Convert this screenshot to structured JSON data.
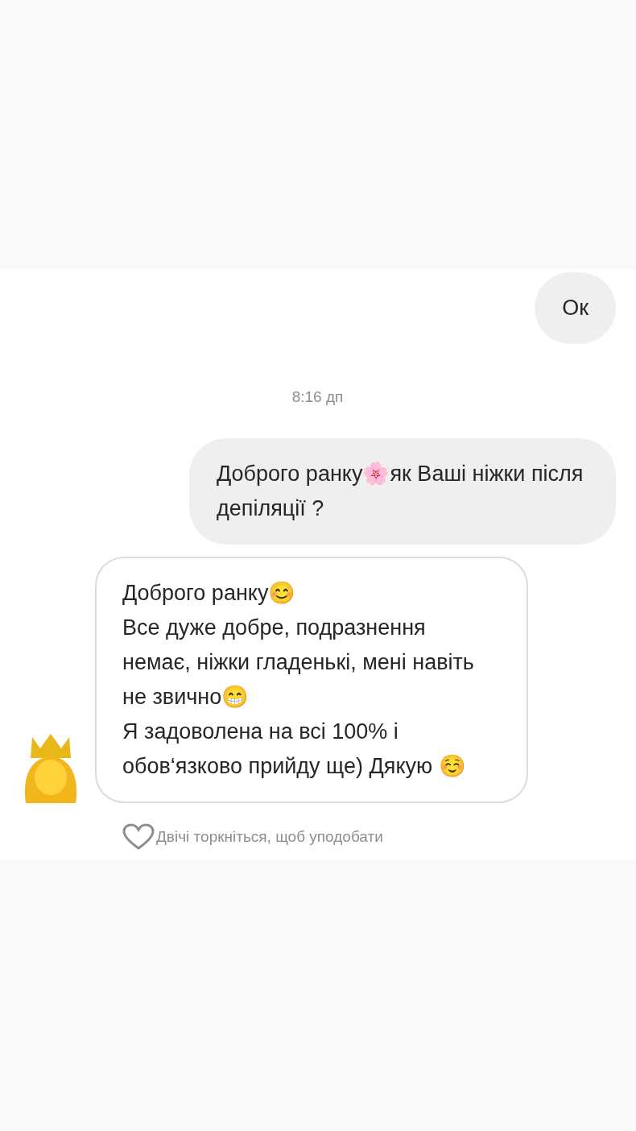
{
  "messages": [
    {
      "kind": "outgoing",
      "text": "Ок"
    },
    {
      "kind": "time",
      "text": "8:16 дп"
    },
    {
      "kind": "outgoing",
      "text": "Доброго ранку🌸як Ваші ніжки після депіляції ?"
    },
    {
      "kind": "incoming",
      "text": "Доброго ранку😊\nВсе дуже добре, подразнення немає, ніжки гладенькі, мені навіть не звично😁\nЯ задоволена на всі 100% і обов‘язково прийду ще) Дякую ☺️",
      "avatar": true
    }
  ],
  "like_hint": "Двічі торкніться, щоб уподобати"
}
